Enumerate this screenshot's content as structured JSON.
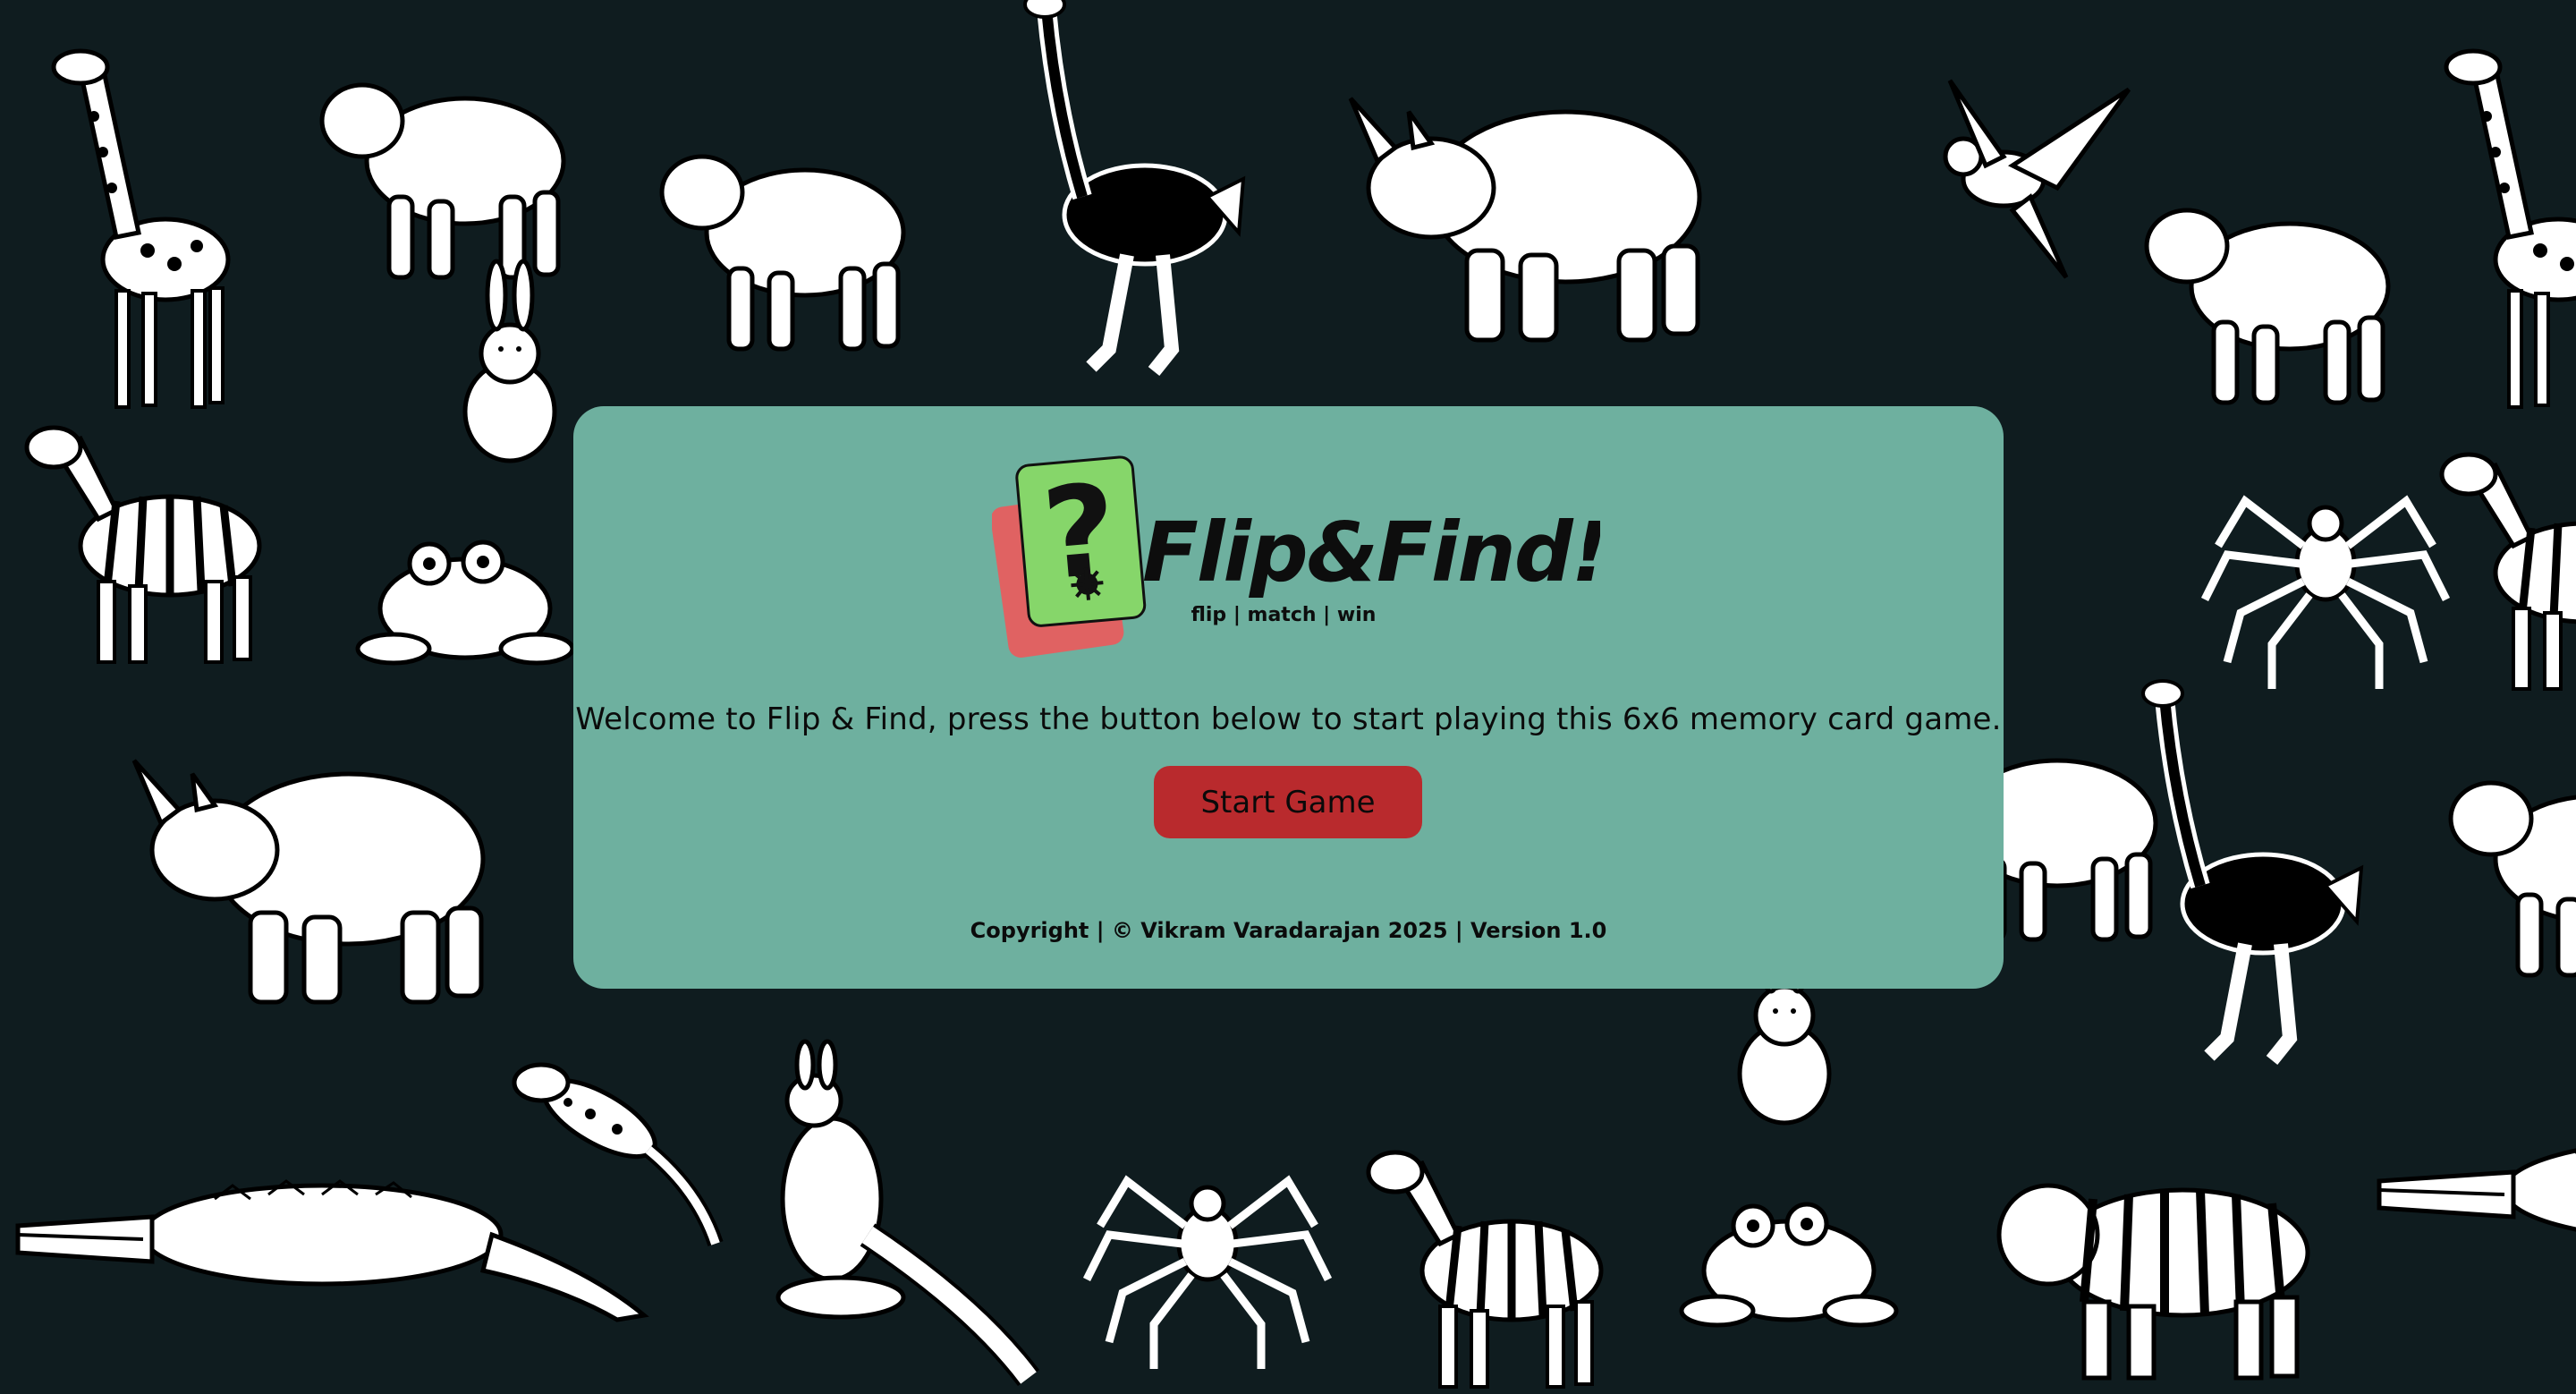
{
  "background": {
    "color": "#0f1c1f",
    "animal_icons": [
      "giraffe-icon",
      "lion-icon",
      "polar-bear-icon",
      "ostrich-icon",
      "rhino-icon",
      "parrot-icon",
      "wolf-icon",
      "rabbit-icon",
      "zebra-icon",
      "frog-icon",
      "spider-icon",
      "kangaroo-icon",
      "crocodile-icon",
      "lizard-icon",
      "tiger-icon"
    ]
  },
  "logo": {
    "title": "Flip&Find!",
    "tagline": "flip | match | win",
    "card_glyph": "?",
    "front_card_color": "#86d66a",
    "back_card_color": "#e06262"
  },
  "panel": {
    "background": "#6eb09f",
    "welcome_text": "Welcome to Flip & Find, press the button below to start playing this 6x6 memory card game.",
    "start_button_label": "Start Game",
    "start_button_color": "#b92a2d",
    "footer_text": "Copyright | © Vikram Varadarajan 2025 | Version 1.0"
  }
}
